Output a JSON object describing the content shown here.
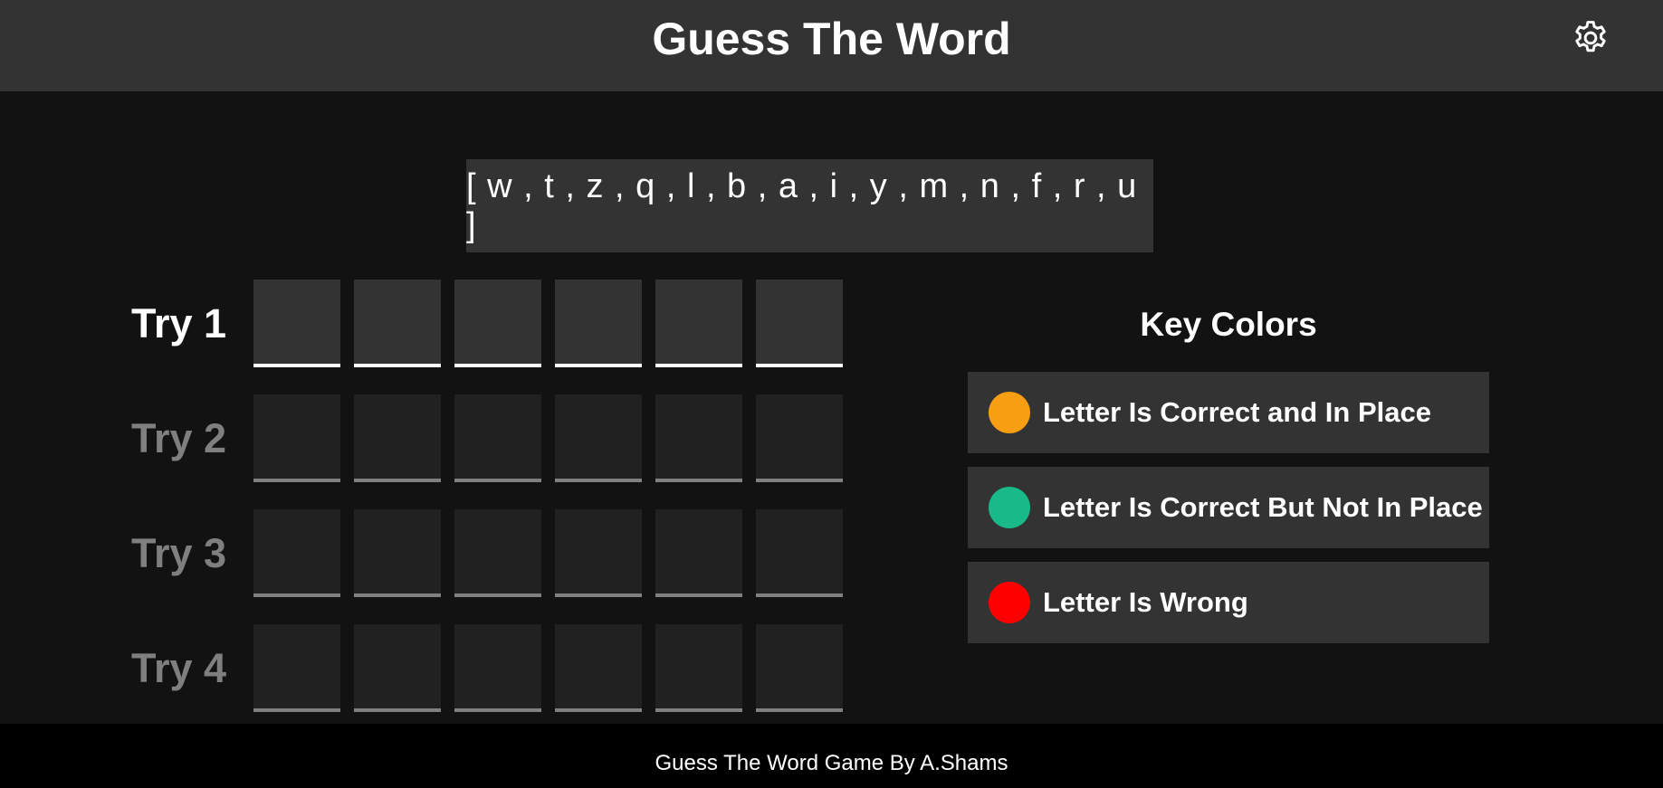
{
  "header": {
    "title": "Guess The Word",
    "settings_icon": "gear-icon"
  },
  "available_letters": "[ w , t , z , q , l , b , a , i , y , m , n , f , r , u ]",
  "tries": [
    {
      "label": "Try 1",
      "active": true,
      "letters": [
        "",
        "",
        "",
        "",
        "",
        ""
      ]
    },
    {
      "label": "Try 2",
      "active": false,
      "letters": [
        "",
        "",
        "",
        "",
        "",
        ""
      ]
    },
    {
      "label": "Try 3",
      "active": false,
      "letters": [
        "",
        "",
        "",
        "",
        "",
        ""
      ]
    },
    {
      "label": "Try 4",
      "active": false,
      "letters": [
        "",
        "",
        "",
        "",
        "",
        ""
      ]
    }
  ],
  "key_colors": {
    "title": "Key Colors",
    "items": [
      {
        "label": "Letter Is Correct and In Place",
        "color": "#f89e13"
      },
      {
        "label": "Letter Is Correct But Not In Place",
        "color": "#18ba89"
      },
      {
        "label": "Letter Is Wrong",
        "color": "#ff0000"
      }
    ]
  },
  "footer": {
    "text": "Guess The Word Game By A.Shams"
  }
}
